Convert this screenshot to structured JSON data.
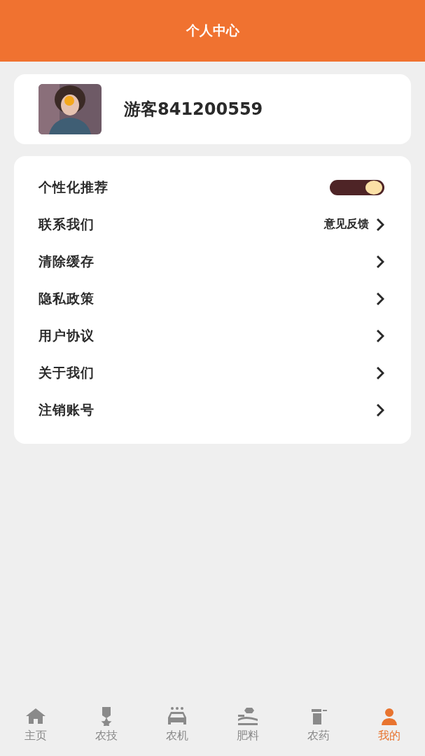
{
  "header": {
    "title": "个人中心"
  },
  "profile": {
    "name": "游客841200559"
  },
  "settings": [
    {
      "kind": "toggle",
      "label": "个性化推荐",
      "on": true
    },
    {
      "kind": "link",
      "label": "联系我们",
      "value": "意见反馈"
    },
    {
      "kind": "link",
      "label": "清除缓存"
    },
    {
      "kind": "link",
      "label": "隐私政策"
    },
    {
      "kind": "link",
      "label": "用户协议"
    },
    {
      "kind": "link",
      "label": "关于我们"
    },
    {
      "kind": "link",
      "label": "注销账号"
    }
  ],
  "tab_bar": [
    {
      "label": "主页",
      "selected": false
    },
    {
      "label": "农技",
      "selected": false
    },
    {
      "label": "农机",
      "selected": false
    },
    {
      "label": "肥料",
      "selected": false
    },
    {
      "label": "农药",
      "selected": false
    },
    {
      "label": "我的",
      "selected": true
    }
  ]
}
